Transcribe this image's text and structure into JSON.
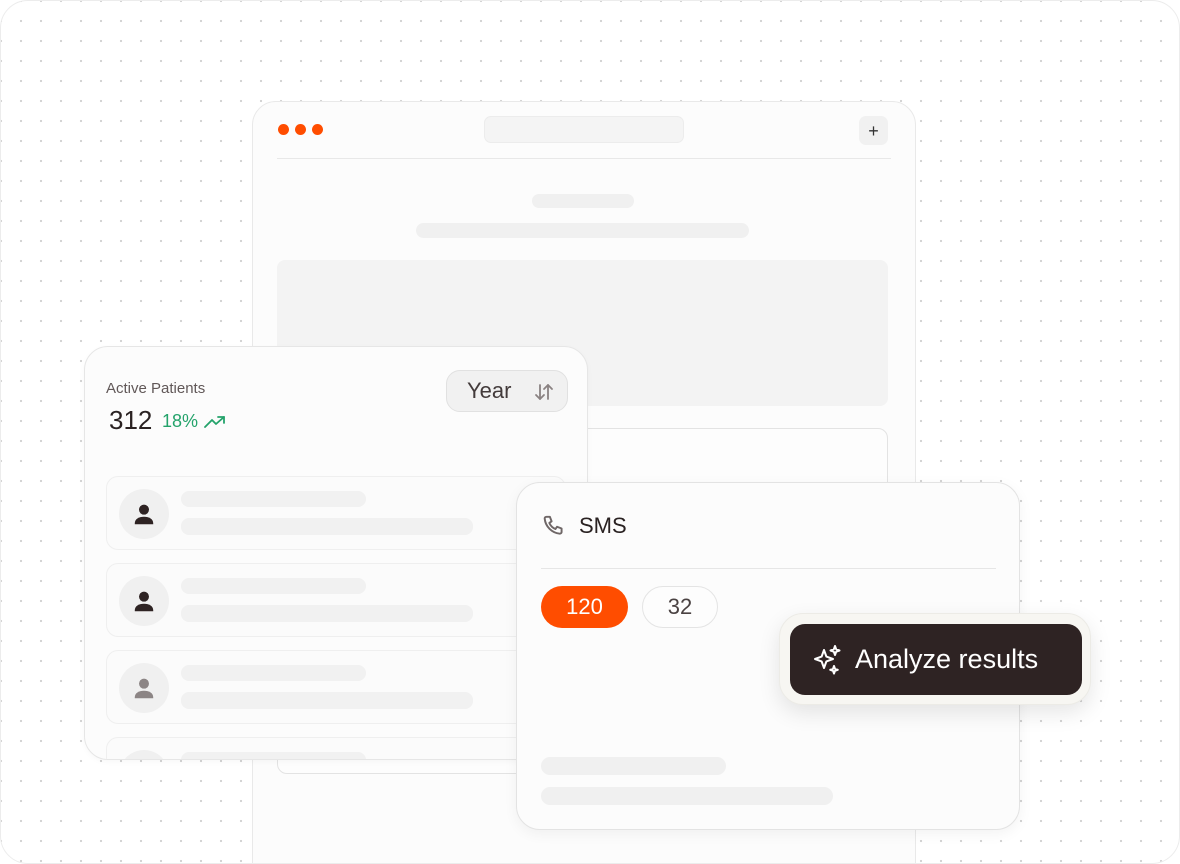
{
  "browser": {
    "window_dots": [
      {
        "name": "window-dot-1",
        "color": "#ff4d00"
      },
      {
        "name": "window-dot-2",
        "color": "#ff4d00"
      },
      {
        "name": "window-dot-3",
        "color": "#ff4d00"
      }
    ],
    "new_tab_label": "+",
    "new_tab_icon": "plus-icon"
  },
  "patients_card": {
    "title": "Active Patients",
    "count": "312",
    "growth": "18%",
    "growth_icon": "trending-up-icon",
    "growth_color": "#24a36b",
    "period_select": {
      "value": "Year",
      "icon": "sort-arrows-icon"
    },
    "rows": [
      {
        "avatar_icon": "user-icon",
        "avatar_color": "#2e2323"
      },
      {
        "avatar_icon": "user-icon",
        "avatar_color": "#2e2323"
      },
      {
        "avatar_icon": "user-icon",
        "avatar_color": "#8c8585"
      }
    ]
  },
  "sms_card": {
    "title": "SMS",
    "icon": "phone-icon",
    "pills": [
      {
        "value": "120",
        "active": true
      },
      {
        "value": "32",
        "active": false
      }
    ]
  },
  "analyze": {
    "label": "Analyze results",
    "icon": "sparkles-icon"
  },
  "colors": {
    "accent": "#ff4d00",
    "dark": "#2e2323",
    "positive": "#24a36b"
  }
}
